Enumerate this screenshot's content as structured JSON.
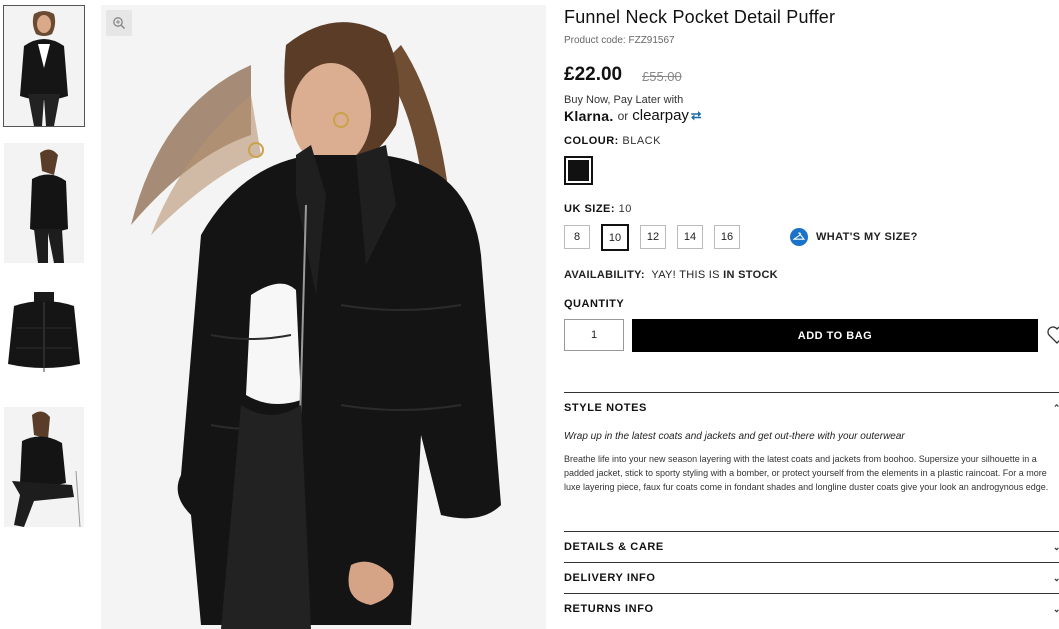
{
  "product": {
    "title": "Funnel Neck Pocket Detail Puffer",
    "product_code": "Product code: FZZ91567",
    "price_now": "£22.00",
    "price_was": "£55.00",
    "bnpl_text": "Buy Now, Pay Later with",
    "klarna": "Klarna.",
    "or": "or",
    "clearpay": "clearpay",
    "colour_label": "COLOUR:",
    "colour_value": "BLACK",
    "size_label": "UK SIZE:",
    "size_value": "10",
    "sizes": [
      "8",
      "10",
      "12",
      "14",
      "16"
    ],
    "selected_size": "10",
    "whats_my_size": "WHAT'S MY SIZE?",
    "availability_label": "AVAILABILITY:",
    "availability_text": "YAY! THIS IS",
    "availability_status": "IN STOCK",
    "quantity_label": "QUANTITY",
    "quantity_value": "1",
    "add_to_bag": "ADD TO BAG"
  },
  "accordion": {
    "style_notes": "STYLE NOTES",
    "style_lead": "Wrap up in the latest coats and jackets and get out-there with your outerwear",
    "style_body": "Breathe life into your new season layering with the latest coats and jackets from boohoo. Supersize your silhouette in a padded jacket, stick to sporty styling with a bomber, or protect yourself from the elements in a plastic raincoat. For a more luxe layering piece, faux fur coats come in fondant shades and longline duster coats give your look an androgynous edge.",
    "details_care": "DETAILS & CARE",
    "delivery_info": "DELIVERY INFO",
    "returns_info": "RETURNS INFO"
  },
  "colors": {
    "accent_blue": "#1a73c9",
    "button_black": "#000000",
    "swatch": "#111111"
  },
  "icons": {
    "zoom": "zoom-icon",
    "hanger": "hanger-icon",
    "wishlist": "heart-icon",
    "chevron": "chevron-icon"
  }
}
